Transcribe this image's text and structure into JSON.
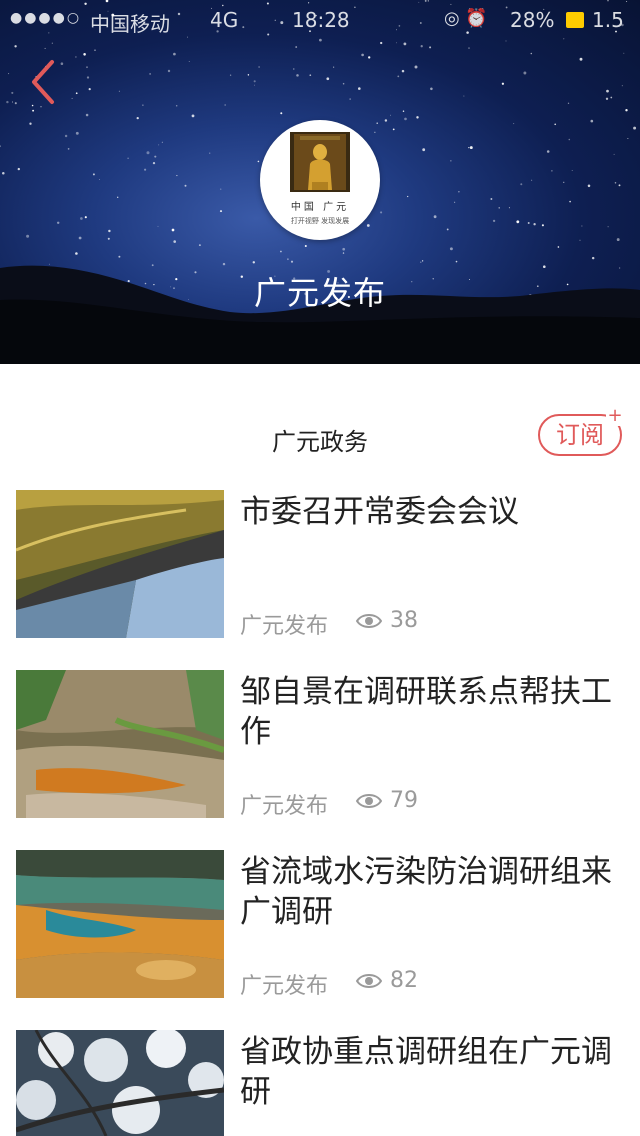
{
  "status_bar": {
    "signal": "●●●●○",
    "carrier": "中国移动",
    "network": "4G",
    "time": "18:28",
    "battery_percent": "28%",
    "tail": "1.5"
  },
  "header": {
    "back_icon": "chevron-left-icon",
    "channel_name": "广元发布",
    "logo_line1": "中国 广元",
    "logo_line2": "打开视野 发现发展"
  },
  "section": {
    "title": "广元政务",
    "subscribe_label": "订阅",
    "subscribe_plus": "+"
  },
  "articles": [
    {
      "title": "市委召开常委会会议",
      "source": "广元发布",
      "views": "38"
    },
    {
      "title": "邹自景在调研联系点帮扶工作",
      "source": "广元发布",
      "views": "79"
    },
    {
      "title": "省流域水污染防治调研组来广调研",
      "source": "广元发布",
      "views": "82"
    },
    {
      "title": "省政协重点调研组在广元调研",
      "source": "",
      "views": ""
    }
  ],
  "colors": {
    "accent": "#e05a5a",
    "meta_text": "#9a9a9a",
    "title_text": "#222222",
    "battery": "#ffcc00"
  }
}
